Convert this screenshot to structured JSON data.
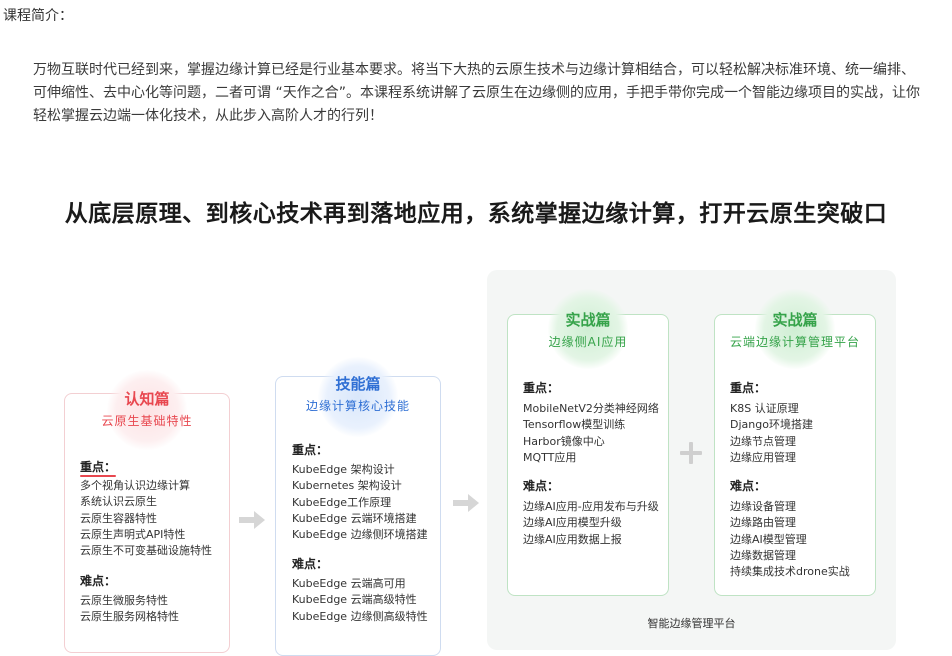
{
  "intro": {
    "label": "课程简介：",
    "text": "万物互联时代已经到来，掌握边缘计算已经是行业基本要求。将当下大热的云原生技术与边缘计算相结合，可以轻松解决标准环境、统一编排、可伸缩性、去中心化等问题，二者可谓 “天作之合”。本课程系统讲解了云原生在边缘侧的应用，手把手带你完成一个智能边缘项目的实战，让你轻松掌握云边端一体化技术，从此步入高阶人才的行列！"
  },
  "headline": "从底层原理、到核心技术再到落地应用，系统掌握边缘计算，打开云原生突破口",
  "cards": [
    {
      "title": "认知篇",
      "subtitle": "云原生基础特性",
      "key_label": "重点：",
      "key_items": [
        "多个视角认识边缘计算",
        "系统认识云原生",
        "云原生容器特性",
        "云原生声明式API特性",
        "云原生不可变基础设施特性"
      ],
      "hard_label": "难点：",
      "hard_items": [
        "云原生微服务特性",
        "云原生服务网格特性"
      ]
    },
    {
      "title": "技能篇",
      "subtitle": "边缘计算核心技能",
      "key_label": "重点：",
      "key_items": [
        "KubeEdge 架构设计",
        "Kubernetes 架构设计",
        "KubeEdge工作原理",
        "KubeEdge 云端环境搭建",
        "KubeEdge 边缘侧环境搭建"
      ],
      "hard_label": "难点：",
      "hard_items": [
        "KubeEdge 云端高可用",
        "KubeEdge 云端高级特性",
        "KubeEdge 边缘侧高级特性"
      ]
    },
    {
      "title": "实战篇",
      "subtitle": "边缘侧AI应用",
      "key_label": "重点：",
      "key_items": [
        "MobileNetV2分类神经网络",
        "Tensorflow模型训练",
        "Harbor镜像中心",
        "MQTT应用"
      ],
      "hard_label": "难点：",
      "hard_items": [
        "边缘AI应用-应用发布与升级",
        "边缘AI应用模型升级",
        "边缘AI应用数据上报"
      ]
    },
    {
      "title": "实战篇",
      "subtitle": "云端边缘计算管理平台",
      "key_label": "重点：",
      "key_items": [
        "K8S 认证原理",
        "Django环境搭建",
        "边缘节点管理",
        "边缘应用管理"
      ],
      "hard_label": "难点：",
      "hard_items": [
        "边缘设备管理",
        "边缘路由管理",
        "边缘AI模型管理",
        "边缘数据管理",
        "持续集成技术drone实战"
      ]
    }
  ],
  "platform_label": "智能边缘管理平台",
  "colors": {
    "red": "#e8474f",
    "blue": "#2f6fd4",
    "green": "#36a34a",
    "arrow": "#d6d6d6",
    "panel": "#f4f6f5"
  },
  "icons": [
    "arrow-right-icon",
    "plus-icon"
  ]
}
